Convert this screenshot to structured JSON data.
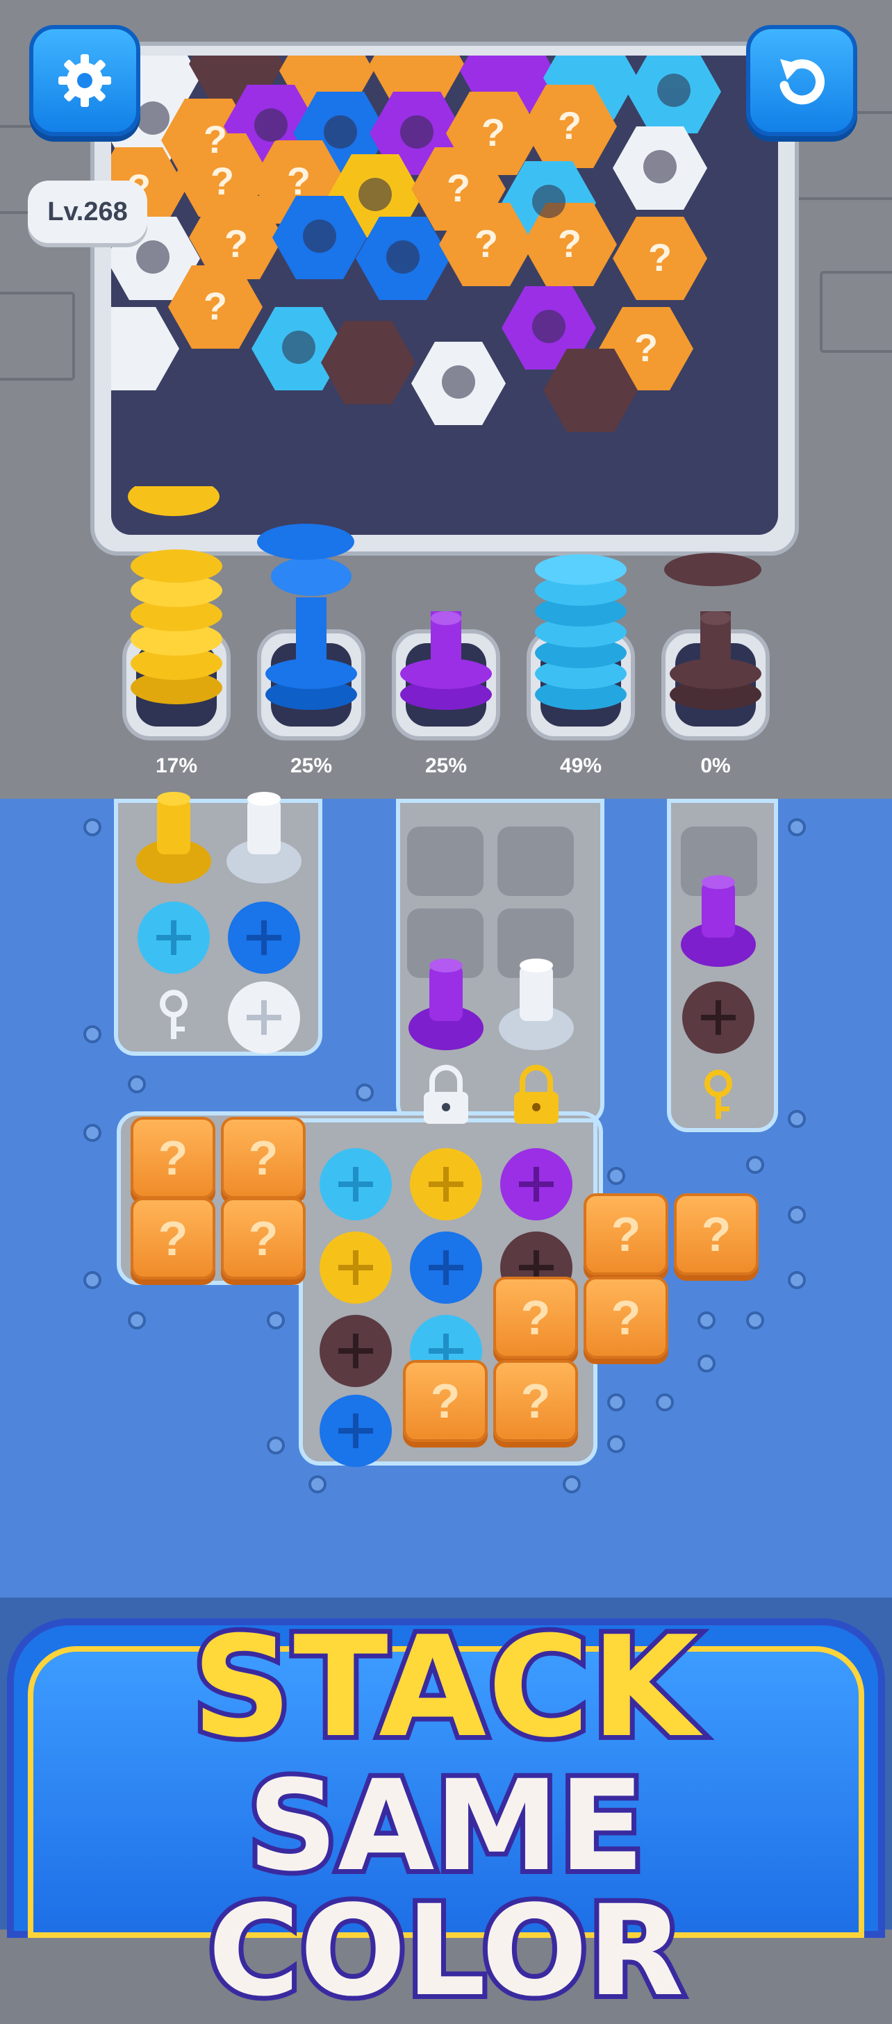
{
  "hud": {
    "settings_icon": "gear-icon",
    "restart_icon": "restart-icon",
    "level": "Lv.268"
  },
  "colors": {
    "yellow": "#f6c21a",
    "blue": "#1a74ea",
    "purple": "#9a2fe6",
    "cyan": "#3cc0f4",
    "brown": "#5b3a42",
    "white": "#eef2f7",
    "orange": "#f39a30",
    "board": "#4f86dc"
  },
  "pegs": [
    {
      "color": "yellow",
      "percent": "17%"
    },
    {
      "color": "blue",
      "percent": "25%"
    },
    {
      "color": "purple",
      "percent": "25%"
    },
    {
      "color": "cyan",
      "percent": "49%"
    },
    {
      "color": "brown",
      "percent": "0%"
    }
  ],
  "mystery_mark": "?",
  "banner": {
    "line1": "STACK",
    "line2": "SAME COLOR"
  }
}
